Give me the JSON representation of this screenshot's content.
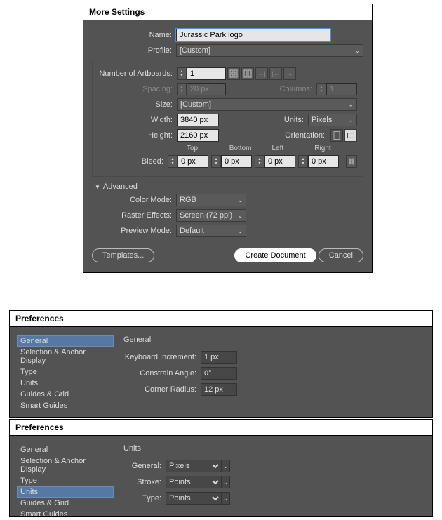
{
  "panelA": {
    "title": "More Settings",
    "labels": {
      "name": "Name:",
      "profile": "Profile:",
      "numArtboards": "Number of Artboards:",
      "spacing": "Spacing:",
      "columns": "Columns:",
      "size": "Size:",
      "width": "Width:",
      "units": "Units:",
      "height": "Height:",
      "orientation": "Orientation:",
      "top": "Top",
      "bottom": "Bottom",
      "left": "Left",
      "right": "Right",
      "bleed": "Bleed:",
      "advanced": "Advanced",
      "colorMode": "Color Mode:",
      "rasterEffects": "Raster Effects:",
      "previewMode": "Preview Mode:"
    },
    "values": {
      "name": "Jurassic Park logo",
      "profile": "[Custom]",
      "numArtboards": "1",
      "spacing": "20 px",
      "columns": "1",
      "size": "[Custom]",
      "width": "3840 px",
      "units": "Pixels",
      "height": "2160 px",
      "bleedTop": "0 px",
      "bleedBottom": "0 px",
      "bleedLeft": "0 px",
      "bleedRight": "0 px",
      "colorMode": "RGB",
      "rasterEffects": "Screen (72 ppi)",
      "previewMode": "Default"
    },
    "buttons": {
      "templates": "Templates...",
      "create": "Create Document",
      "cancel": "Cancel"
    }
  },
  "panelB": {
    "title": "Preferences",
    "sidebar": [
      "General",
      "Selection & Anchor Display",
      "Type",
      "Units",
      "Guides & Grid",
      "Smart Guides"
    ],
    "heading": "General",
    "labels": {
      "ki": "Keyboard Increment:",
      "ca": "Constrain Angle:",
      "cr": "Corner Radius:"
    },
    "values": {
      "ki": "1 px",
      "ca": "0°",
      "cr": "12 px"
    }
  },
  "panelC": {
    "title": "Preferences",
    "sidebar": [
      "General",
      "Selection & Anchor Display",
      "Type",
      "Units",
      "Guides & Grid",
      "Smart Guides"
    ],
    "heading": "Units",
    "labels": {
      "gen": "General:",
      "stroke": "Stroke:",
      "type": "Type:"
    },
    "values": {
      "gen": "Pixels",
      "stroke": "Points",
      "type": "Points"
    }
  }
}
